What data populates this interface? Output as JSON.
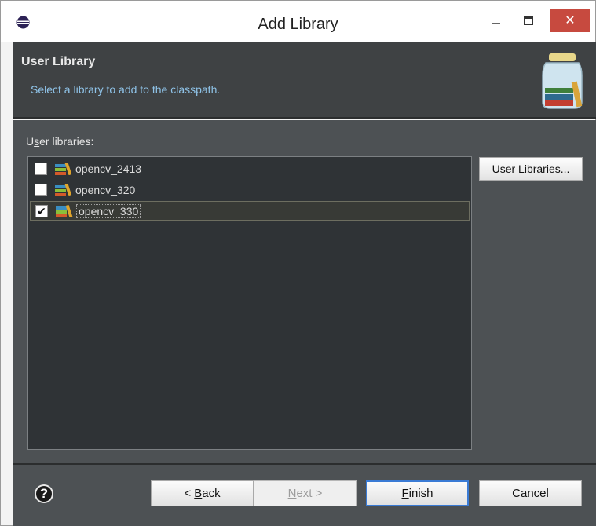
{
  "window": {
    "title": "Add Library",
    "close_glyph": "✕"
  },
  "banner": {
    "title": "User Library",
    "description": "Select a library to add to the classpath."
  },
  "content": {
    "libraries_label_pre": "U",
    "libraries_label_mnemonic": "s",
    "libraries_label_post": "er libraries:",
    "libraries": [
      {
        "name": "opencv_2413",
        "checked": false,
        "check_glyph": ""
      },
      {
        "name": "opencv_320",
        "checked": false,
        "check_glyph": ""
      },
      {
        "name": "opencv_330",
        "checked": true,
        "check_glyph": "✔"
      }
    ],
    "user_libraries_button_mnemonic": "U",
    "user_libraries_button_rest": "ser Libraries..."
  },
  "footer": {
    "help_glyph": "?",
    "back_prefix": "< ",
    "back_mnemonic": "B",
    "back_rest": "ack",
    "next_mnemonic": "N",
    "next_rest": "ext >",
    "finish_mnemonic": "F",
    "finish_rest": "inish",
    "cancel_label": "Cancel"
  },
  "icons": {
    "app": "eclipse-icon",
    "library": "library-books-icon",
    "banner": "library-jar-icon"
  },
  "colors": {
    "close_button": "#c74a3f",
    "banner_bg": "#3f4244",
    "description": "#8fc3e8",
    "default_button_border": "#3a7bd5"
  }
}
